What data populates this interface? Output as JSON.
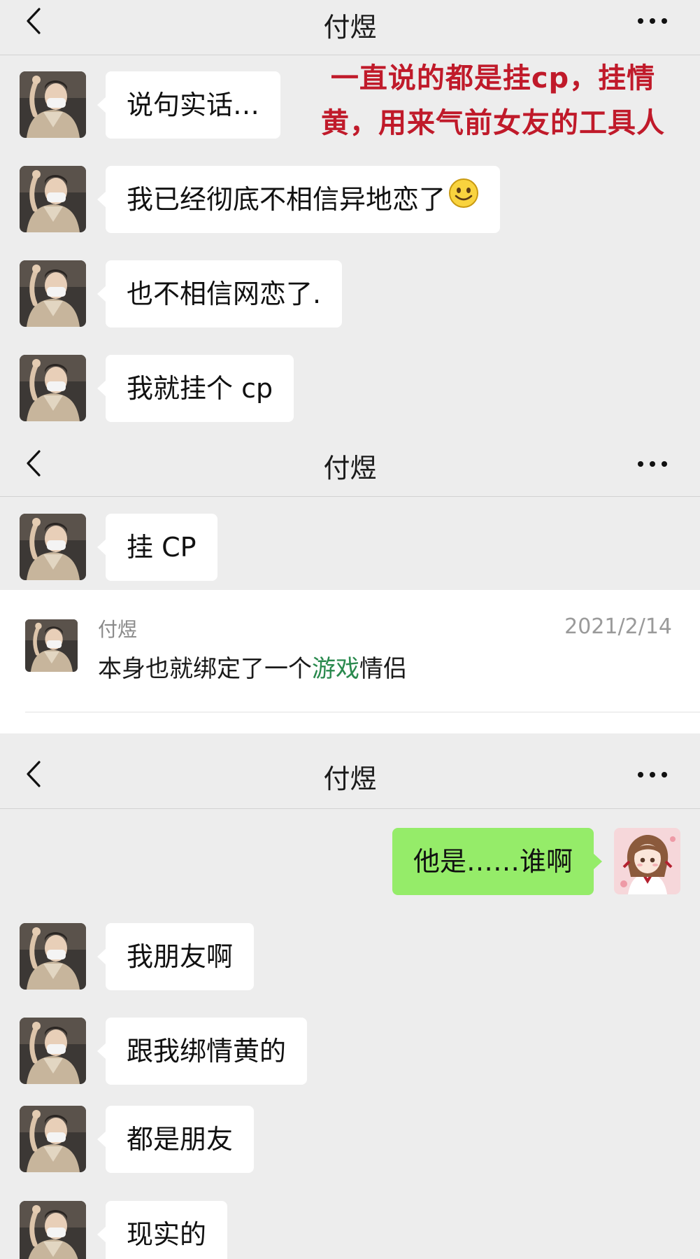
{
  "annotation": {
    "line1": "一直说的都是挂cp，挂情",
    "line2": "黄，用来气前女友的工具人",
    "color": "#c01a2a"
  },
  "screens": [
    {
      "title": "付煜",
      "messages": [
        "说句实话…",
        "我已经彻底不相信异地恋了",
        "也不相信网恋了.",
        "我就挂个 cp"
      ]
    },
    {
      "title": "付煜",
      "messages": [
        "挂 CP"
      ],
      "search_result": {
        "sender": "付煜",
        "date": "2021/2/14",
        "text_before": "本身也就绑定了一个",
        "highlight": "游戏",
        "text_after": "情侣"
      }
    },
    {
      "title": "付煜",
      "my_message": "他是……谁啊",
      "messages": [
        "我朋友啊",
        "跟我绑情黄的",
        "都是朋友",
        "现实的"
      ]
    }
  ],
  "icons": {
    "back": "chevron-left-icon",
    "more": "more-dots-icon",
    "emoji": "smile-emoji-icon",
    "avatar_contact": "male-avatar-icon",
    "avatar_me": "anime-girl-avatar-icon"
  },
  "colors": {
    "background": "#ededed",
    "bubble_incoming": "#ffffff",
    "bubble_outgoing": "#95ec69",
    "search_highlight": "#2a8a4e"
  }
}
